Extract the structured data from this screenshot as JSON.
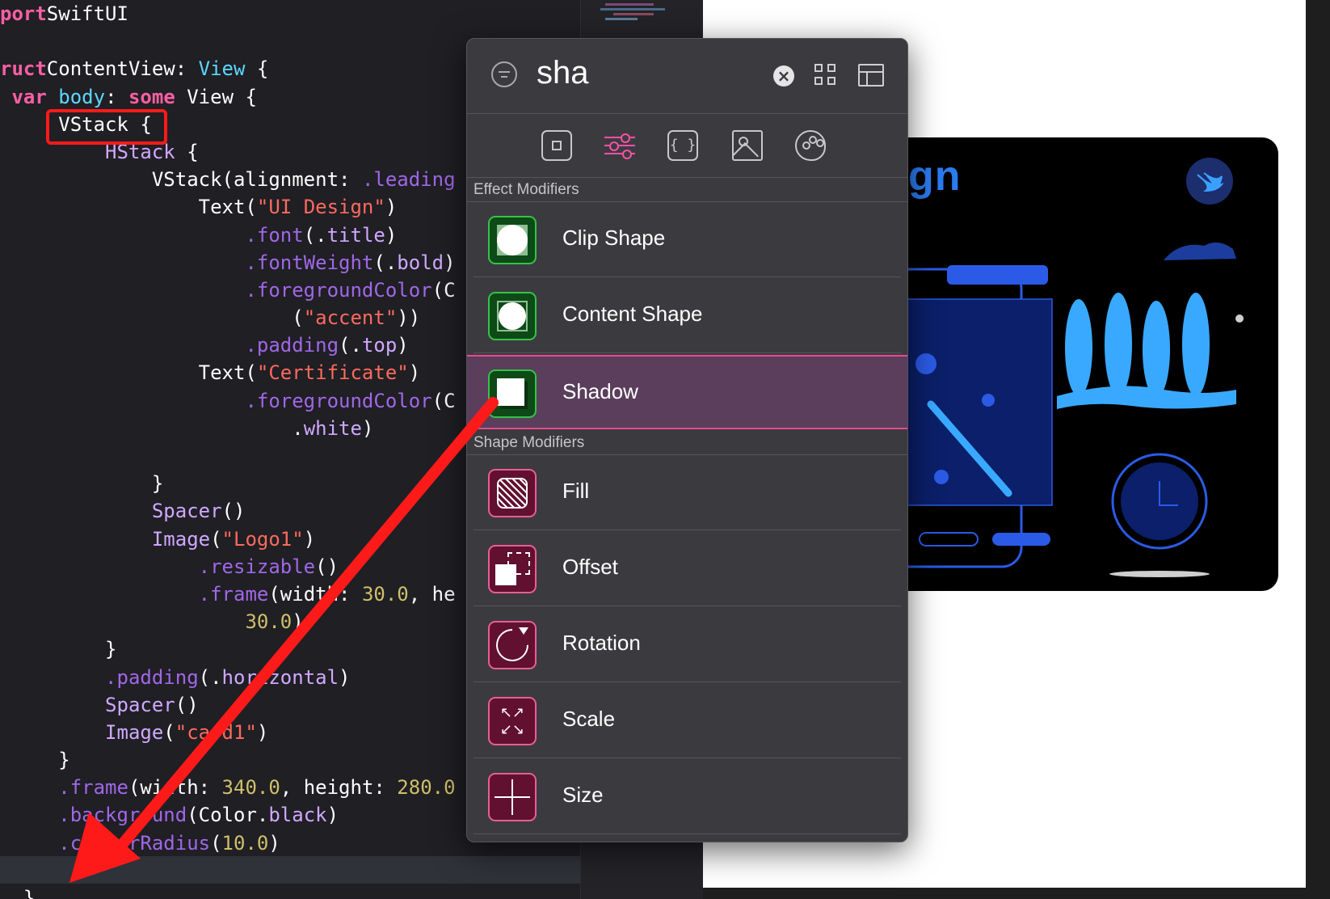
{
  "editor": {
    "lines": [
      [
        [
          "kw",
          "port"
        ],
        [
          "",
          "SwiftUI"
        ]
      ],
      [],
      [
        [
          "kw",
          "ruct"
        ],
        [
          "",
          "ContentView: "
        ],
        [
          "ty",
          "View"
        ],
        [
          "",
          " {"
        ]
      ],
      [
        [
          "",
          " "
        ],
        [
          "kw",
          "var"
        ],
        [
          "",
          " "
        ],
        [
          "ty",
          "body"
        ],
        [
          "",
          ": "
        ],
        [
          "kw",
          "some"
        ],
        [
          "",
          " View {"
        ]
      ],
      [
        [
          "",
          "     VStack {"
        ]
      ],
      [
        [
          "",
          "         "
        ],
        [
          "pr",
          "HStack"
        ],
        [
          "",
          " {"
        ]
      ],
      [
        [
          "",
          "             VStack(alignment: "
        ],
        [
          "fn",
          ".leading"
        ]
      ],
      [
        [
          "",
          "                 Text("
        ],
        [
          "st",
          "\"UI Design\""
        ],
        [
          "",
          ")"
        ]
      ],
      [
        [
          "",
          "                     "
        ],
        [
          "fn",
          ".font"
        ],
        [
          "",
          "(."
        ],
        [
          "pr",
          "title"
        ],
        [
          "",
          ")"
        ]
      ],
      [
        [
          "",
          "                     "
        ],
        [
          "fn",
          ".fontWeight"
        ],
        [
          "",
          "(."
        ],
        [
          "pr",
          "bold"
        ],
        [
          "",
          ")"
        ]
      ],
      [
        [
          "",
          "                     "
        ],
        [
          "fn",
          ".foregroundColor"
        ],
        [
          "",
          "(C"
        ]
      ],
      [
        [
          "",
          "                         ("
        ],
        [
          "st",
          "\"accent\""
        ],
        [
          "",
          "))"
        ]
      ],
      [
        [
          "",
          "                     "
        ],
        [
          "fn",
          ".padding"
        ],
        [
          "",
          "(."
        ],
        [
          "pr",
          "top"
        ],
        [
          "",
          ")"
        ]
      ],
      [
        [
          "",
          "                 Text("
        ],
        [
          "st",
          "\"Certificate\""
        ],
        [
          "",
          ")"
        ]
      ],
      [
        [
          "",
          "                     "
        ],
        [
          "fn",
          ".foregroundColor"
        ],
        [
          "",
          "(C"
        ]
      ],
      [
        [
          "",
          "                         ."
        ],
        [
          "pr",
          "white"
        ],
        [
          "",
          ")"
        ]
      ],
      [],
      [
        [
          "",
          "             }"
        ]
      ],
      [
        [
          "",
          "             "
        ],
        [
          "pr",
          "Spacer"
        ],
        [
          "",
          "()"
        ]
      ],
      [
        [
          "",
          "             "
        ],
        [
          "pr",
          "Image"
        ],
        [
          "",
          "("
        ],
        [
          "st",
          "\"Logo1\""
        ],
        [
          "",
          ")"
        ]
      ],
      [
        [
          "",
          "                 "
        ],
        [
          "fn",
          ".resizable"
        ],
        [
          "",
          "()"
        ]
      ],
      [
        [
          "",
          "                 "
        ],
        [
          "fn",
          ".frame"
        ],
        [
          "",
          "(width: "
        ],
        [
          "nm",
          "30.0"
        ],
        [
          "",
          ", he"
        ]
      ],
      [
        [
          "",
          "                     "
        ],
        [
          "nm",
          "30.0"
        ],
        [
          "",
          ")"
        ]
      ],
      [
        [
          "",
          "         }"
        ]
      ],
      [
        [
          "",
          "         "
        ],
        [
          "fn",
          ".padding"
        ],
        [
          "",
          "(."
        ],
        [
          "pr",
          "horizontal"
        ],
        [
          "",
          ")"
        ]
      ],
      [
        [
          "",
          "         "
        ],
        [
          "pr",
          "Spacer"
        ],
        [
          "",
          "()"
        ]
      ],
      [
        [
          "",
          "         "
        ],
        [
          "pr",
          "Image"
        ],
        [
          "",
          "("
        ],
        [
          "st",
          "\"card1\""
        ],
        [
          "",
          ")"
        ]
      ],
      [
        [
          "",
          "     }"
        ]
      ],
      [
        [
          "",
          "     "
        ],
        [
          "fn",
          ".frame"
        ],
        [
          "",
          "(width: "
        ],
        [
          "nm",
          "340.0"
        ],
        [
          "",
          ", height: "
        ],
        [
          "nm",
          "280.0"
        ]
      ],
      [
        [
          "",
          "     "
        ],
        [
          "fn",
          ".background"
        ],
        [
          "",
          "(Color."
        ],
        [
          "pr",
          "black"
        ],
        [
          "",
          ")"
        ]
      ],
      [
        [
          "",
          "     "
        ],
        [
          "fn",
          ".cornerRadius"
        ],
        [
          "",
          "("
        ],
        [
          "nm",
          "10.0"
        ],
        [
          "",
          ")"
        ]
      ],
      [],
      [
        [
          "",
          "  }"
        ]
      ]
    ]
  },
  "preview": {
    "card_title": "gn"
  },
  "popover": {
    "search": {
      "value": "sha"
    },
    "categories": [
      "view-icon",
      "modifiers-icon",
      "code-icon",
      "image-icon",
      "palette-icon"
    ],
    "sections": [
      {
        "title": "Effect Modifiers",
        "items": [
          {
            "label": "Clip Shape",
            "icon": "clip-shape-icon",
            "selected": false
          },
          {
            "label": "Content Shape",
            "icon": "content-shape-icon",
            "selected": false
          },
          {
            "label": "Shadow",
            "icon": "shadow-icon",
            "selected": true
          }
        ]
      },
      {
        "title": "Shape Modifiers",
        "items": [
          {
            "label": "Fill",
            "icon": "fill-icon",
            "selected": false
          },
          {
            "label": "Offset",
            "icon": "offset-icon",
            "selected": false
          },
          {
            "label": "Rotation",
            "icon": "rotation-icon",
            "selected": false
          },
          {
            "label": "Scale",
            "icon": "scale-icon",
            "selected": false
          },
          {
            "label": "Size",
            "icon": "size-icon",
            "selected": false
          }
        ]
      }
    ]
  },
  "colors": {
    "keyword": "#fc5fa3",
    "type": "#5dd8ff",
    "function": "#a167e6",
    "property": "#d0a8ff",
    "string": "#fc6a5d",
    "number": "#d0bf69",
    "annotation": "#ff1a1a",
    "selection": "#e84a8e"
  }
}
